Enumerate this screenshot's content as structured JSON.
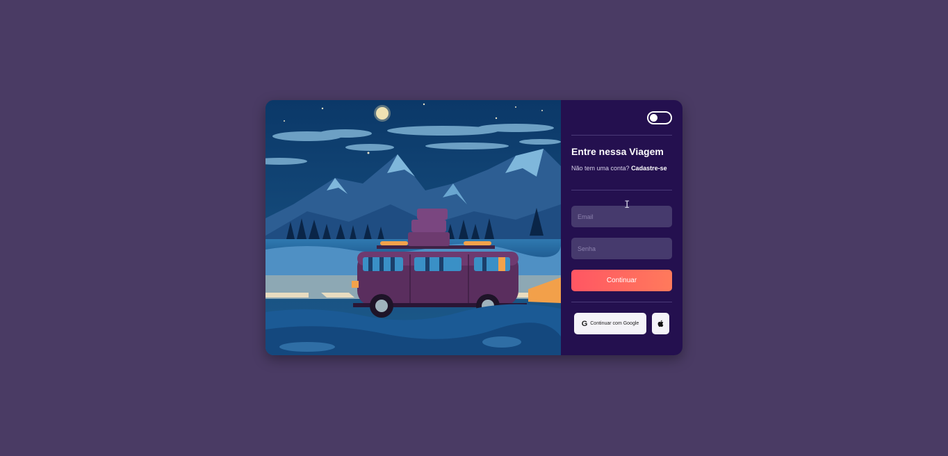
{
  "colors": {
    "page_background": "#4a3b64",
    "panel_background": "#24104f",
    "input_background": "#463a6d",
    "button_gradient_start": "#ff5663",
    "button_gradient_end": "#ff7a5c"
  },
  "illustration": {
    "icon": "van-night-mountains-illustration"
  },
  "theme_toggle": {
    "icon": "toggle-switch-icon",
    "state": "off"
  },
  "login": {
    "title": "Entre nessa Viagem",
    "subtitle_prefix": "Não tem uma conta?",
    "signup_link": "Cadastre-se",
    "email_placeholder": "Email",
    "password_placeholder": "Senha",
    "continue_label": "Continuar",
    "google_label": "Continuar com Google",
    "google_icon": "google-icon",
    "apple_icon": "apple-icon"
  }
}
